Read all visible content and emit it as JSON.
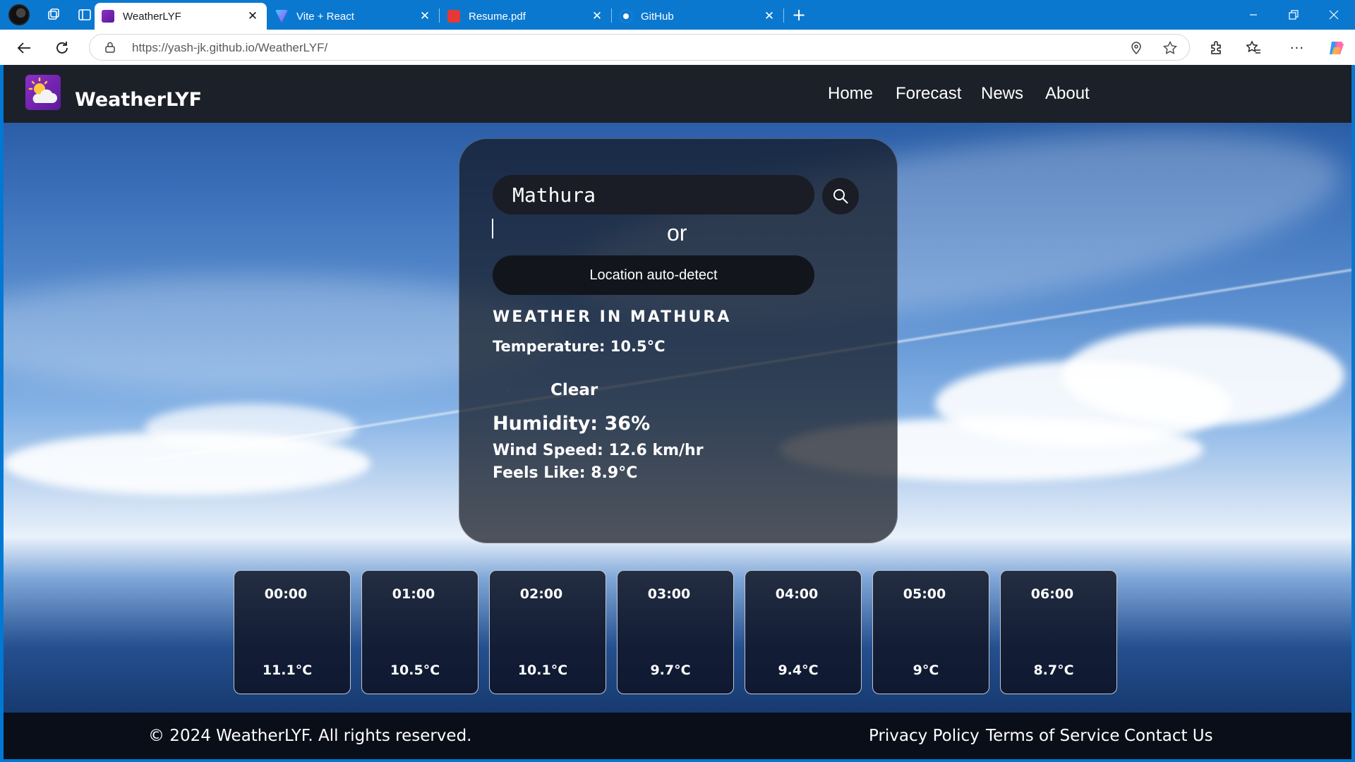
{
  "browser": {
    "tabs": [
      {
        "label": "WeatherLYF",
        "active": true
      },
      {
        "label": "Vite + React",
        "active": false
      },
      {
        "label": "Resume.pdf",
        "active": false
      },
      {
        "label": "GitHub",
        "active": false
      }
    ],
    "url": "https://yash-jk.github.io/WeatherLYF/"
  },
  "header": {
    "brand": "WeatherLYF",
    "nav": [
      "Home",
      "Forecast",
      "News",
      "About"
    ]
  },
  "search": {
    "value": "Mathura",
    "or_label": "or",
    "auto_detect_label": "Location auto-detect"
  },
  "weather": {
    "title": "WEATHER IN MATHURA",
    "temperature": "Temperature: 10.5°C",
    "condition": "Clear",
    "humidity": "Humidity: 36%",
    "wind": "Wind Speed: 12.6 km/hr",
    "feels_like": "Feels Like: 8.9°C"
  },
  "hourly": [
    {
      "time": "00:00",
      "temp": "11.1°C",
      "icon": "moon-icon"
    },
    {
      "time": "01:00",
      "temp": "10.5°C",
      "icon": "moon-icon"
    },
    {
      "time": "02:00",
      "temp": "10.1°C",
      "icon": "moon-icon"
    },
    {
      "time": "03:00",
      "temp": "9.7°C",
      "icon": "moon-icon"
    },
    {
      "time": "04:00",
      "temp": "9.4°C",
      "icon": "moon-icon"
    },
    {
      "time": "05:00",
      "temp": "9°C",
      "icon": "moon-icon"
    },
    {
      "time": "06:00",
      "temp": "8.7°C",
      "icon": "moon-icon"
    }
  ],
  "footer": {
    "copyright": "© 2024 WeatherLYF. All rights reserved.",
    "links": [
      "Privacy Policy",
      "Terms of Service",
      "Contact Us"
    ]
  },
  "colors": {
    "browser_accent": "#0b78d0",
    "header_bg": "#1c2029",
    "footer_bg": "#0a0e18",
    "moon": "#ffffff"
  }
}
